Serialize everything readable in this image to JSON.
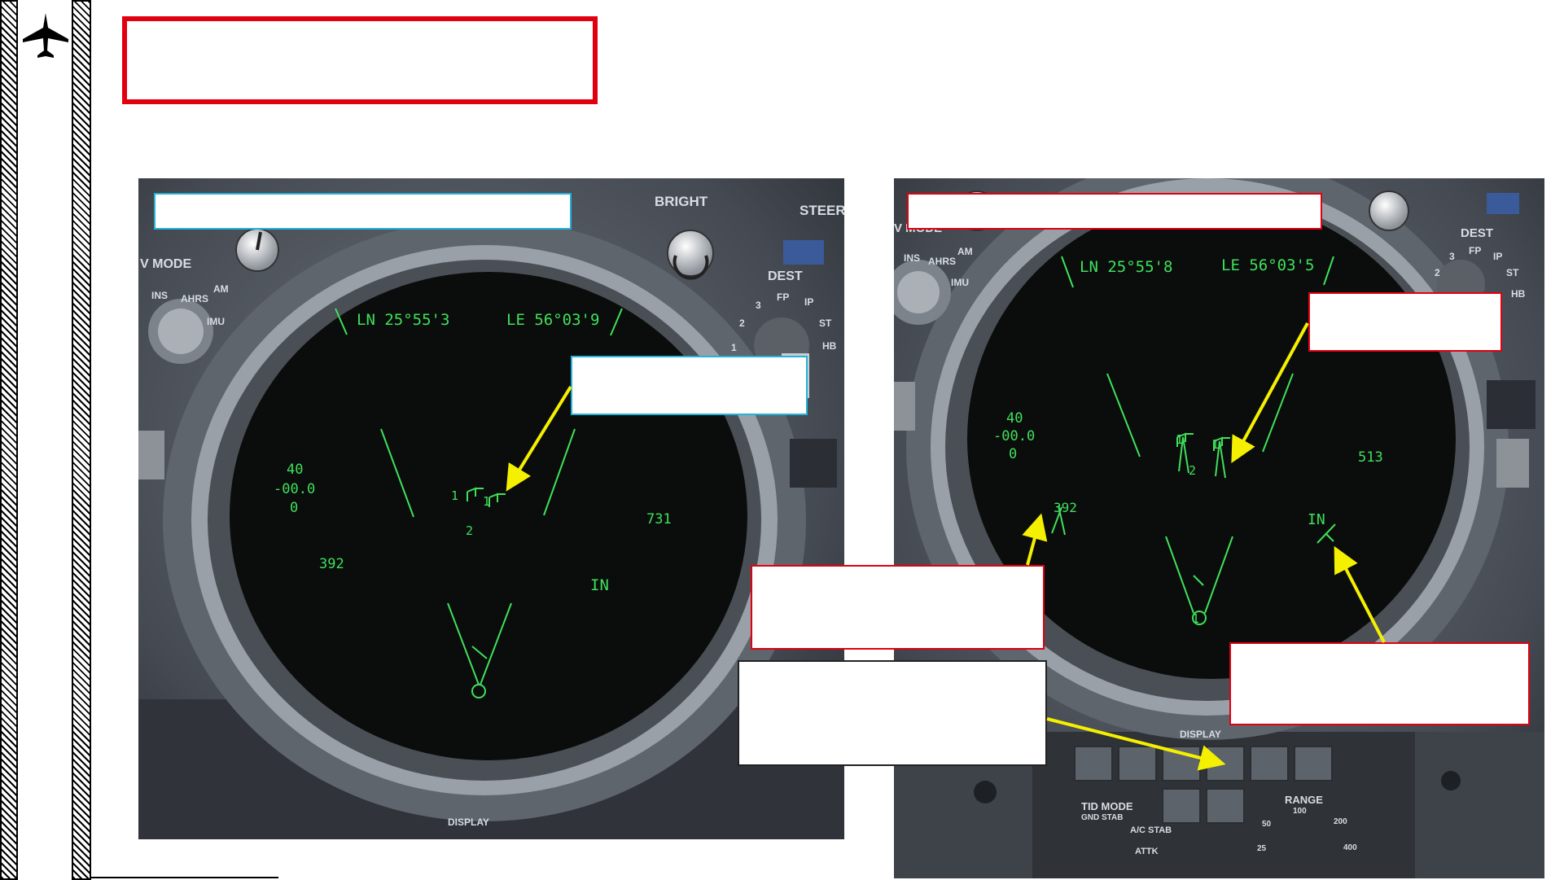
{
  "page": {
    "title_box_text": ""
  },
  "colors": {
    "hud_green": "#3fe05a",
    "callout_red": "#e0000f",
    "callout_cyan": "#25b2d9",
    "arrow_yellow": "#f4f000"
  },
  "icons": {
    "sidebar_logo": "jet-aircraft-icon"
  },
  "left_panel": {
    "placards": {
      "bright": "BRIGHT",
      "steer": "STEER",
      "nav_mode": "V MODE",
      "ins": "INS",
      "ahrs": "AHRS",
      "am": "AM",
      "imu": "IMU",
      "dest": "DEST",
      "fp": "FP",
      "ip": "IP",
      "st": "ST",
      "hb": "HB",
      "dest_3": "3",
      "dest_2": "2",
      "dest_1": "1",
      "display": "DISPLAY"
    },
    "hud": {
      "ln": "LN  25°55'3",
      "le": "LE  56°03'9",
      "alt": "40",
      "vs": "-00.0",
      "zero": "0",
      "track_392": "392",
      "track_731": "731",
      "in_label": "IN",
      "symbol_1a": "1",
      "symbol_1b": "1",
      "symbol_2": "2"
    },
    "callout_top_text": "",
    "callout_target_text": ""
  },
  "right_panel": {
    "placards": {
      "nav_mode": "V MODE",
      "ins": "INS",
      "ahrs": "AHRS",
      "am": "AM",
      "imu": "IMU",
      "dest": "DEST",
      "fp": "FP",
      "ip": "IP",
      "st": "ST",
      "hb": "HB",
      "dest_3": "3",
      "dest_2": "2",
      "display": "DISPLAY",
      "tid_mode": "TID MODE",
      "gnd_stab": "GND STAB",
      "ac_stab": "A/C STAB",
      "attk": "ATTK",
      "range": "RANGE",
      "r100": "100",
      "r50": "50",
      "r200": "200",
      "r25": "25",
      "r400": "400"
    },
    "hud": {
      "ln": "LN  25°55'8",
      "le": "LE  56°03'5",
      "alt": "40",
      "vs": "-00.0",
      "zero": "0",
      "track_392": "392",
      "track_513": "513",
      "in_label": "IN",
      "symbol_1a": "1",
      "symbol_1b": "1",
      "symbol_2": "2",
      "own_1": "1"
    },
    "callout_top_text": "",
    "callout_target_text": "",
    "callout_track_text": "",
    "callout_in_text": "",
    "callout_display_text": ""
  }
}
